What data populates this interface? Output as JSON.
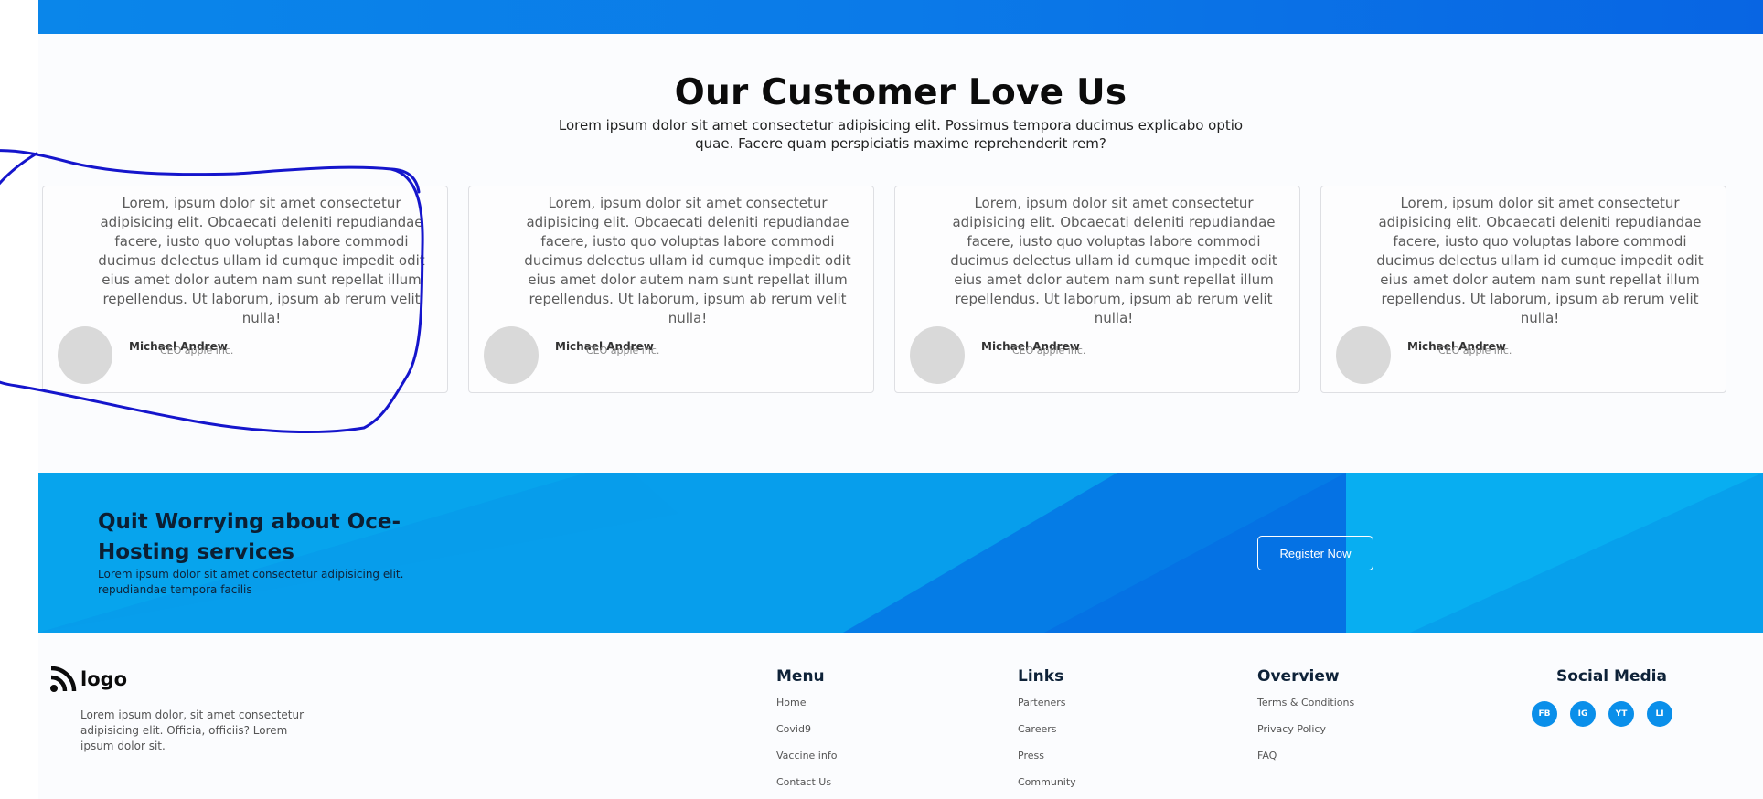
{
  "testimonials": {
    "title": "Our Customer Love Us",
    "subtitle": "Lorem ipsum dolor sit amet consectetur adipisicing elit. Possimus tempora ducimus explicabo optio quae. Facere quam perspiciatis maxime reprehenderit rem?",
    "cards": [
      {
        "text": "Lorem, ipsum dolor sit amet consectetur adipisicing elit. Obcaecati deleniti repudiandae facere, iusto quo voluptas labore commodi ducimus delectus ullam id cumque impedit odit eius amet dolor autem nam sunt repellat illum repellendus. Ut laborum, ipsum ab rerum velit nulla!",
        "name": "Michael Andrew",
        "role": "CEO apple inc."
      },
      {
        "text": "Lorem, ipsum dolor sit amet consectetur adipisicing elit. Obcaecati deleniti repudiandae facere, iusto quo voluptas labore commodi ducimus delectus ullam id cumque impedit odit eius amet dolor autem nam sunt repellat illum repellendus. Ut laborum, ipsum ab rerum velit nulla!",
        "name": "Michael Andrew",
        "role": "CEO apple inc."
      },
      {
        "text": "Lorem, ipsum dolor sit amet consectetur adipisicing elit. Obcaecati deleniti repudiandae facere, iusto quo voluptas labore commodi ducimus delectus ullam id cumque impedit odit eius amet dolor autem nam sunt repellat illum repellendus. Ut laborum, ipsum ab rerum velit nulla!",
        "name": "Michael Andrew",
        "role": "CEO apple inc."
      },
      {
        "text": "Lorem, ipsum dolor sit amet consectetur adipisicing elit. Obcaecati deleniti repudiandae facere, iusto quo voluptas labore commodi ducimus delectus ullam id cumque impedit odit eius amet dolor autem nam sunt repellat illum repellendus. Ut laborum, ipsum ab rerum velit nulla!",
        "name": "Michael Andrew",
        "role": "CEO apple inc."
      }
    ]
  },
  "cta": {
    "title": "Quit Worrying about Oce-Hosting services",
    "description": "Lorem ipsum dolor sit amet consectetur adipisicing elit. repudiandae tempora facilis",
    "button_label": "Register Now"
  },
  "footer": {
    "logo_text": "logo",
    "logo_icon": "rss-icon",
    "description": "Lorem ipsum dolor, sit amet consectetur adipisicing elit. Officia, officiis? Lorem ipsum dolor sit.",
    "menu": {
      "title": "Menu",
      "links": [
        "Home",
        "Covid9",
        "Vaccine info",
        "Contact Us"
      ]
    },
    "links": {
      "title": "Links",
      "links": [
        "Parteners",
        "Careers",
        "Press",
        "Community"
      ]
    },
    "overview": {
      "title": "Overview",
      "links": [
        "Terms & Conditions",
        "Privacy Policy",
        "FAQ"
      ]
    },
    "social": {
      "title": "Social Media",
      "items": [
        "FB",
        "IG",
        "YT",
        "LI"
      ]
    }
  },
  "colors": {
    "banner_blue": "#0b7ae8",
    "cta_blue": "#06a6ee",
    "social_blue": "#0a8fea",
    "annotation_ink": "#1515cc"
  }
}
